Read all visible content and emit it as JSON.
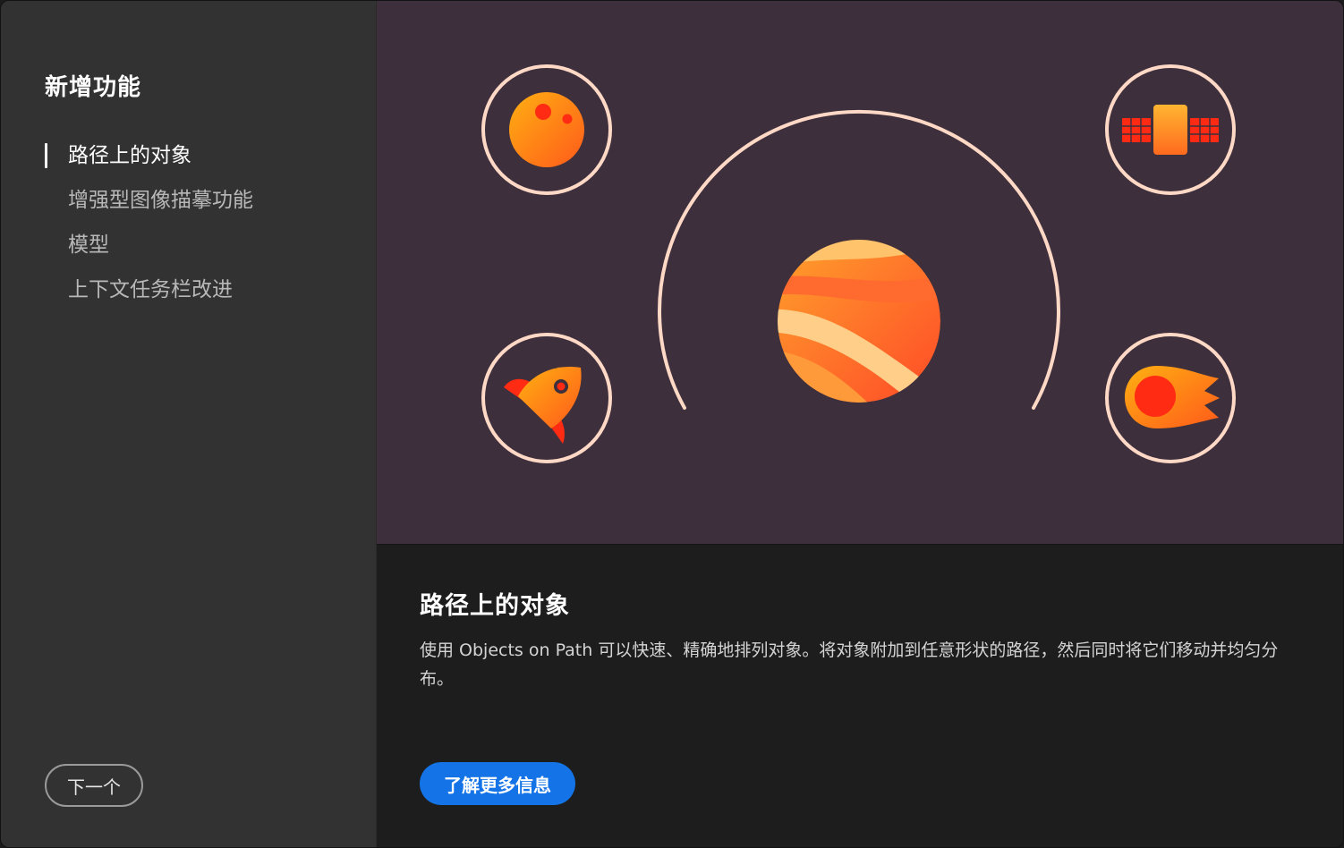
{
  "sidebar": {
    "title": "新增功能",
    "items": [
      {
        "label": "路径上的对象",
        "active": true
      },
      {
        "label": "增强型图像描摹功能",
        "active": false
      },
      {
        "label": "模型",
        "active": false
      },
      {
        "label": "上下文任务栏改进",
        "active": false
      }
    ],
    "next_label": "下一个"
  },
  "hero": {
    "background_color": "#3d2f3c",
    "ring_color": "#ffd9c6",
    "icons": [
      "moon-icon",
      "satellite-icon",
      "rocket-icon",
      "comet-icon",
      "planet-icon"
    ]
  },
  "content": {
    "title": "路径上的对象",
    "description": "使用 Objects on Path 可以快速、精确地排列对象。将对象附加到任意形状的路径，然后同时将它们移动并均匀分布。",
    "learn_more_label": "了解更多信息",
    "accent_color": "#1473e6"
  }
}
